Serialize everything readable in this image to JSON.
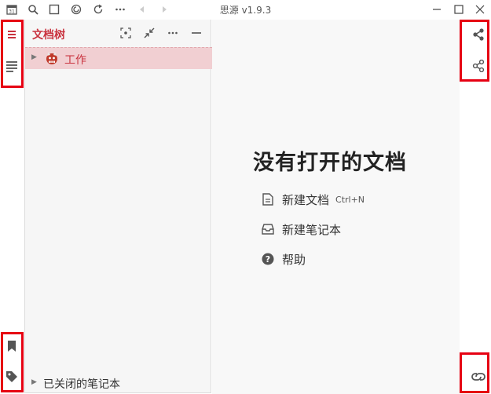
{
  "titlebar": {
    "title": "思源 v1.9.3",
    "left_icons": [
      "calendar-icon",
      "search-icon",
      "square-icon",
      "sync-icon",
      "refresh-icon",
      "more-icon",
      "back-icon",
      "forward-icon"
    ],
    "calendar_day": "31"
  },
  "left_dock": {
    "items": [
      "file-tree-icon",
      "outline-icon",
      "bookmark-icon",
      "tag-icon"
    ]
  },
  "file_tree": {
    "title": "文档树",
    "notebook": {
      "label": "工作"
    },
    "closed_notebooks_label": "已关闭的笔记本"
  },
  "main": {
    "empty_title": "没有打开的文档",
    "actions": [
      {
        "label": "新建文档",
        "shortcut": "Ctrl+N"
      },
      {
        "label": "新建笔记本"
      },
      {
        "label": "帮助"
      }
    ]
  },
  "right_dock": {
    "items": [
      "graph-view-icon",
      "global-graph-icon",
      "backlinks-icon"
    ]
  },
  "colors": {
    "accent": "#c9333f",
    "highlight_box": "#e60012",
    "selected_row": "#f1cfd2"
  }
}
